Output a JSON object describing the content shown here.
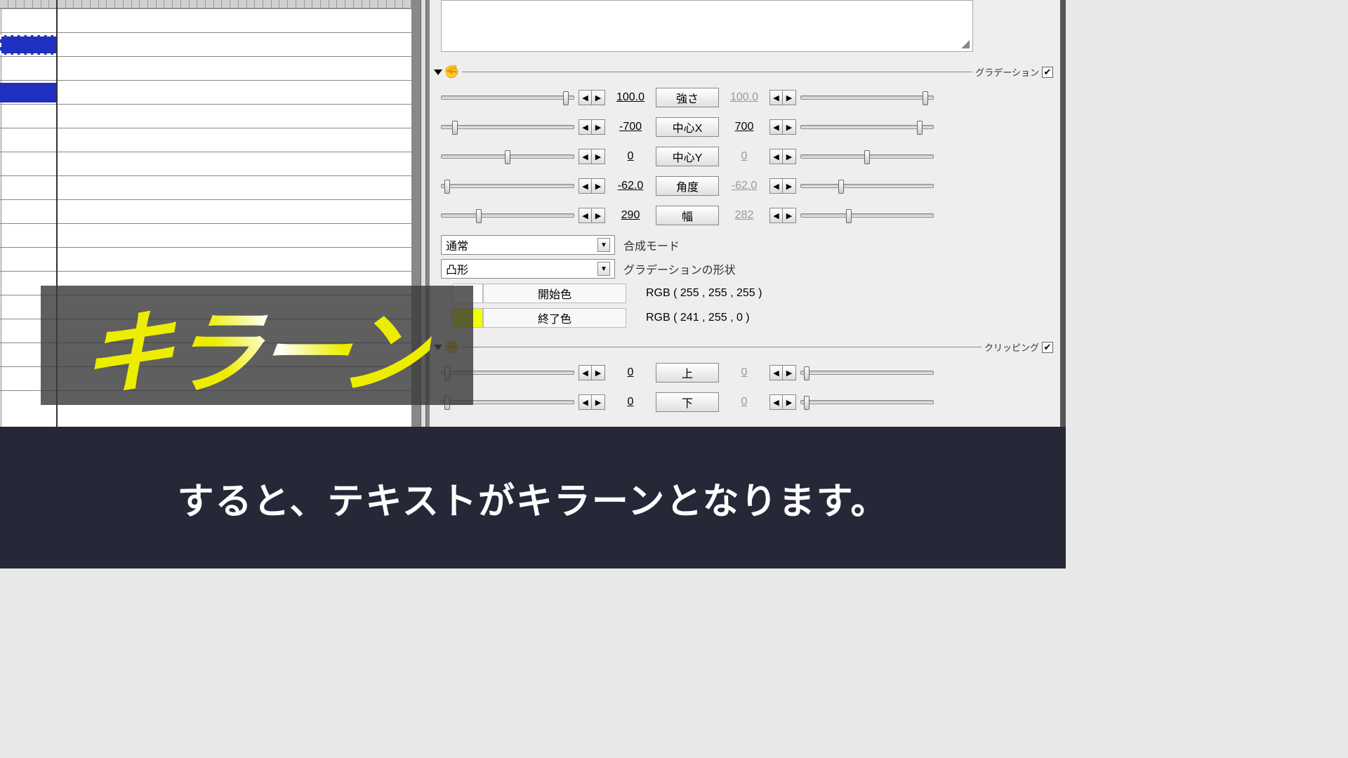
{
  "sections": {
    "gradation": {
      "label": "グラデーション",
      "checked": "✔"
    },
    "clipping": {
      "label": "クリッピング",
      "checked": "✔"
    }
  },
  "props": {
    "strength": {
      "label": "強さ",
      "l": "100.0",
      "r": "100.0",
      "ls": 92,
      "rs": 92
    },
    "cx": {
      "label": "中心X",
      "l": "-700",
      "r": "700",
      "ls": 8,
      "rs": 88
    },
    "cy": {
      "label": "中心Y",
      "l": "0",
      "r": "0",
      "ls": 48,
      "rs": 48
    },
    "angle": {
      "label": "角度",
      "l": "-62.0",
      "r": "-62.0",
      "ls": 2,
      "rs": 28
    },
    "width": {
      "label": "幅",
      "l": "290",
      "r": "282",
      "ls": 26,
      "rs": 34
    }
  },
  "dropdowns": {
    "blend": {
      "value": "通常",
      "label": "合成モード"
    },
    "shape": {
      "value": "凸形",
      "label": "グラデーションの形状"
    }
  },
  "colors": {
    "start": {
      "label": "開始色",
      "text": "RGB ( 255 , 255 , 255 )"
    },
    "end": {
      "label": "終了色",
      "text": "RGB ( 241 , 255 , 0 )"
    }
  },
  "clip": {
    "top": {
      "label": "上",
      "l": "0",
      "r": "0"
    },
    "bottom": {
      "label": "下",
      "l": "0",
      "r": "0"
    }
  },
  "overlay": "キラーン",
  "subtitle": "すると、テキストがキラーンとなります。"
}
